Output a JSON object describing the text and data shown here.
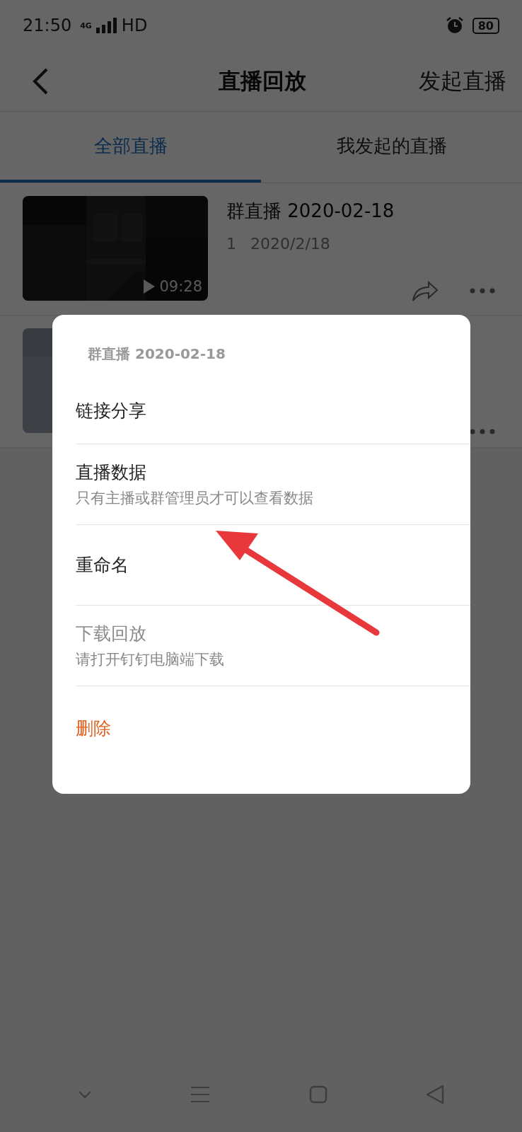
{
  "status_bar": {
    "time": "21:50",
    "network": "4G",
    "hd": "HD",
    "battery": "80"
  },
  "header": {
    "title": "直播回放",
    "action": "发起直播"
  },
  "tabs": [
    {
      "label": "全部直播",
      "selected": true
    },
    {
      "label": "我发起的直播",
      "selected": false
    }
  ],
  "videos": [
    {
      "kind": "picture",
      "title": "群直播 2020-02-18",
      "count": "1",
      "date": "2020/2/18",
      "duration": "09:28"
    },
    {
      "kind": "picture"
    }
  ],
  "dialog": {
    "title": "群直播 2020-02-18",
    "items": [
      {
        "label": "链接分享",
        "kind": "normal",
        "disabled": false
      },
      {
        "label": "直播数据",
        "subtitle": "只有主播或群管理员才可以查看数据",
        "kind": "normal",
        "disabled": false
      },
      {
        "label": "重命名",
        "kind": "normal",
        "disabled": false
      },
      {
        "label": "下载回放",
        "subtitle": "请打开钉钉电脑端下载",
        "kind": "normal",
        "disabled": true
      },
      {
        "label": "删除",
        "kind": "danger",
        "disabled": false
      }
    ]
  }
}
